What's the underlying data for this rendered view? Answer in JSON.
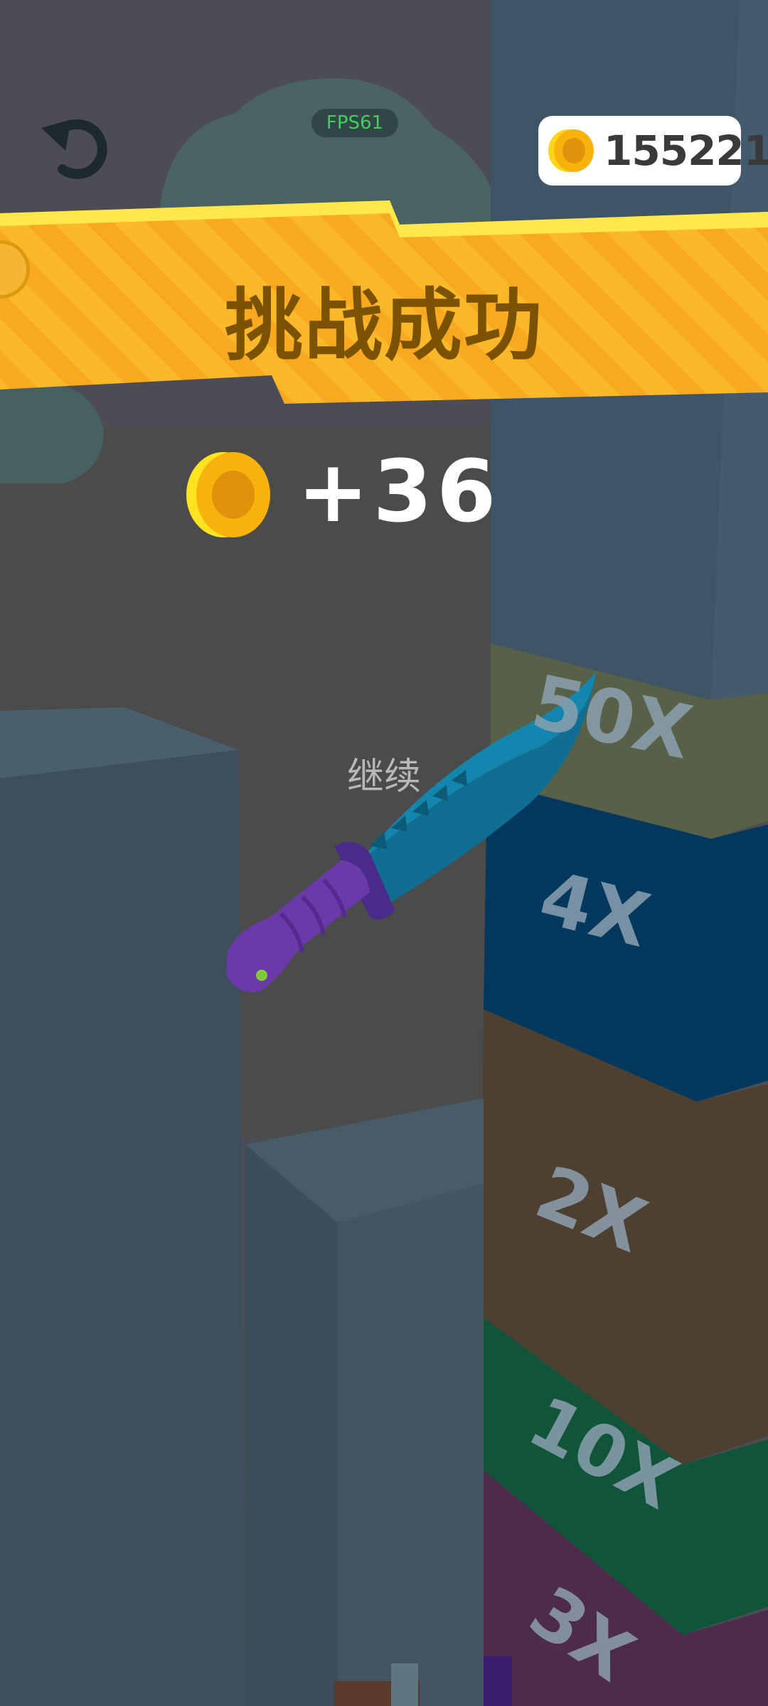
{
  "hud": {
    "fps_label": "FPS61",
    "coin_total": "155221",
    "restart_icon": "restart-arrow-icon"
  },
  "banner": {
    "title": "挑战成功"
  },
  "reward": {
    "amount": "+36"
  },
  "continue_label": "继续",
  "tower": {
    "multipliers": [
      "50X",
      "4X",
      "2X",
      "10X",
      "3X"
    ]
  },
  "colors": {
    "banner_yellow": "#fbb829",
    "banner_highlight": "#ffe94a",
    "coin_gold": "#f5c518",
    "fps_green": "#3fd15a"
  }
}
